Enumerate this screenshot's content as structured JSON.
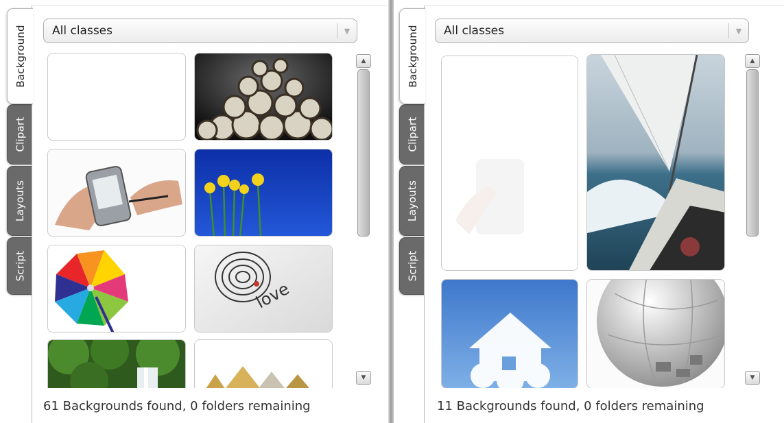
{
  "panels": [
    {
      "tabs": [
        "Background",
        "Clipart",
        "Layouts",
        "Script"
      ],
      "active_tab": "Background",
      "class_select": {
        "value": "All classes"
      },
      "thumbnails": [
        "blank",
        "alarm clocks",
        "hands with PDA",
        "yellow daffodils",
        "rainbow pinwheel",
        "love target",
        "forest waterfall",
        "golden houses"
      ],
      "status": "61 Backgrounds found, 0 folders remaining"
    },
    {
      "tabs": [
        "Background",
        "Clipart",
        "Layouts",
        "Script"
      ],
      "active_tab": "Background",
      "class_select": {
        "value": "All classes"
      },
      "thumbnails": [
        "blank faded",
        "sailboat",
        "cloud house",
        "puzzle globe"
      ],
      "status": "11 Backgrounds found, 0 folders remaining"
    }
  ],
  "icons": {
    "scroll_up": "triangle-up-icon",
    "scroll_down": "triangle-down-icon",
    "dropdown": "chevron-down-icon"
  }
}
